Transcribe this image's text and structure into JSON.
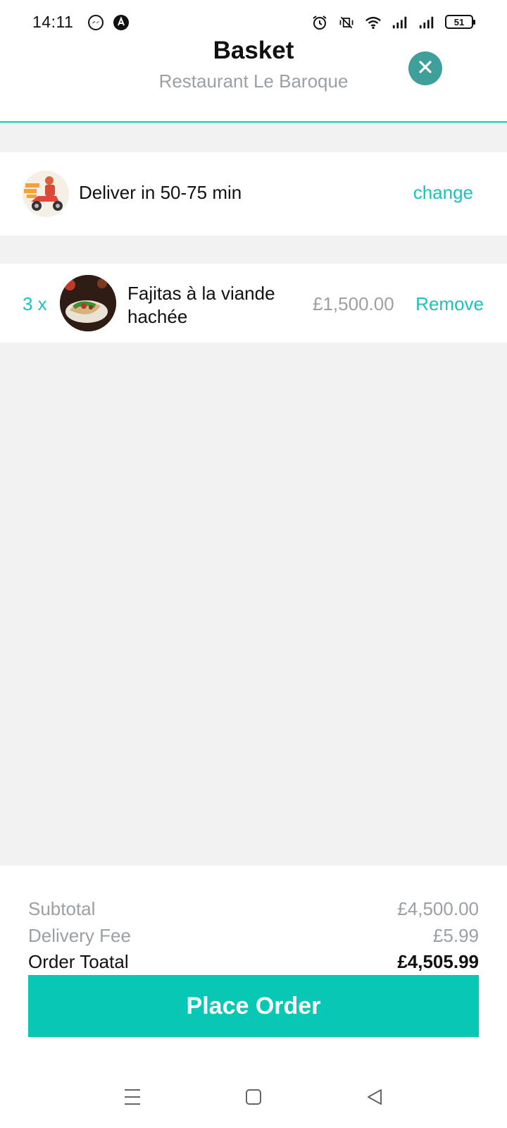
{
  "status_bar": {
    "time": "14:11",
    "battery": "51",
    "left_icons": [
      "messenger-icon",
      "app-notification-icon"
    ],
    "right_icons": [
      "alarm-icon",
      "vibrate-icon",
      "wifi-icon",
      "signal-icon",
      "signal-icon"
    ]
  },
  "header": {
    "title": "Basket",
    "subtitle": "Restaurant Le Baroque",
    "close_icon": "close-icon"
  },
  "delivery": {
    "text": "Deliver in 50-75 min",
    "change_label": "change"
  },
  "items": [
    {
      "quantity": "3 x",
      "name": "Fajitas à la viande hachée",
      "price": "£1,500.00",
      "remove_label": "Remove"
    }
  ],
  "summary": {
    "subtotal_label": "Subtotal",
    "subtotal_value": "£4,500.00",
    "delivery_fee_label": "Delivery Fee",
    "delivery_fee_value": "£5.99",
    "total_label": "Order Toatal",
    "total_value": "£4,505.99",
    "place_order_label": "Place Order"
  },
  "colors": {
    "accent": "#19c4b8",
    "button": "#07c8b5",
    "close_button": "#3f9f9a",
    "muted_text": "#9aa0a6",
    "background": "#f2f2f2"
  },
  "nav_bar": {
    "icons": [
      "menu-icon",
      "home-icon",
      "back-icon"
    ]
  }
}
